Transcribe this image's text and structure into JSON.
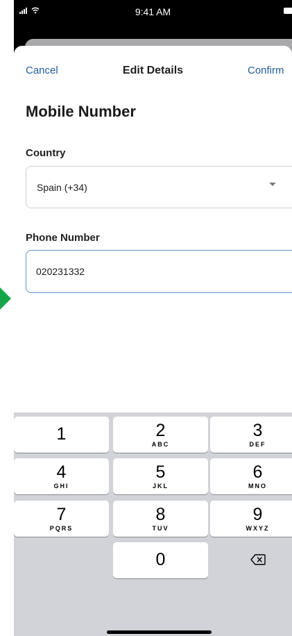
{
  "status_bar": {
    "time": "9:41 AM"
  },
  "nav": {
    "cancel_label": "Cancel",
    "title": "Edit Details",
    "confirm_label": "Confirm"
  },
  "page": {
    "heading": "Mobile Number"
  },
  "form": {
    "country_label": "Country",
    "country_value": "Spain (+34)",
    "phone_label": "Phone Number",
    "phone_value": "020231332"
  },
  "keypad": {
    "keys": [
      {
        "digit": "1",
        "letters": ""
      },
      {
        "digit": "2",
        "letters": "ABC"
      },
      {
        "digit": "3",
        "letters": "DEF"
      },
      {
        "digit": "4",
        "letters": "GHI"
      },
      {
        "digit": "5",
        "letters": "JKL"
      },
      {
        "digit": "6",
        "letters": "MNO"
      },
      {
        "digit": "7",
        "letters": "PQRS"
      },
      {
        "digit": "8",
        "letters": "TUV"
      },
      {
        "digit": "9",
        "letters": "WXYZ"
      },
      {
        "digit": "0",
        "letters": ""
      }
    ],
    "delete_icon": "backspace-icon"
  },
  "colors": {
    "link": "#1f5c99",
    "input_focus_border": "#5d93c8",
    "keyboard_bg": "#d1d3d9",
    "indicator_arrow": "#15a64a"
  }
}
